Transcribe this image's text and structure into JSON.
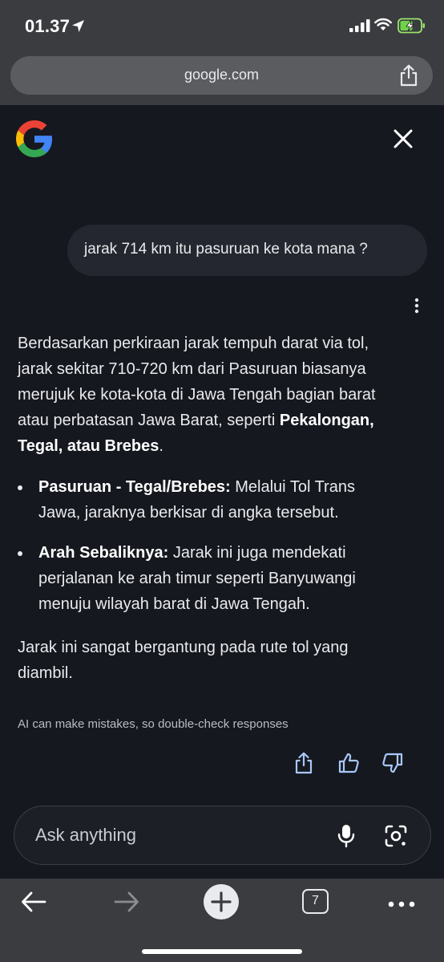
{
  "status_bar": {
    "time": "01.37",
    "icons": [
      "location-arrow-icon",
      "signal-icon",
      "wifi-icon",
      "battery-charging-icon"
    ]
  },
  "browser": {
    "url": "google.com",
    "share_icon": "share-icon"
  },
  "assistant": {
    "logo": "google-g-logo",
    "close_icon": "close-icon",
    "user_query": "jarak 714 km itu pasuruan ke kota mana ?",
    "answer": {
      "intro_line1": "Berdasarkan perkiraan jarak tempuh darat via tol,",
      "intro_line2": "jarak sekitar 710-720 km dari Pasuruan biasanya",
      "intro_line3": "merujuk ke kota-kota di Jawa Tengah bagian barat",
      "intro_line4": "atau perbatasan Jawa Barat, seperti ",
      "intro_bold1": "Pekalongan,",
      "intro_bold2": "Tegal, atau Brebes",
      "intro_end": ".",
      "bullets": [
        {
          "title": "Pasuruan - Tegal/Brebes:",
          "line1": " Melalui Tol Trans",
          "line2": "Jawa, jaraknya berkisar di angka tersebut."
        },
        {
          "title": "Arah Sebaliknya:",
          "line1": " Jarak ini juga mendekati",
          "line2": "perjalanan ke arah timur seperti Banyuwangi",
          "line3": "menuju wilayah barat di Jawa Tengah."
        }
      ],
      "closing_line1": "Jarak ini sangat bergantung pada rute tol yang",
      "closing_line2": "diambil."
    },
    "disclaimer": "AI can make mistakes, so double-check responses",
    "input_placeholder": "Ask anything"
  },
  "toolbar": {
    "tab_count": "7"
  },
  "colors": {
    "background": "#16181f",
    "chrome": "#3a3c40",
    "accent_blue": "#a8c7fa",
    "text": "#e8eaed"
  }
}
